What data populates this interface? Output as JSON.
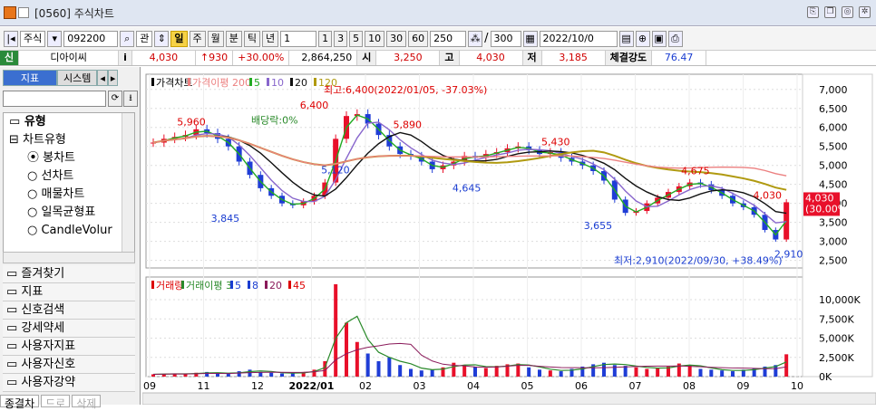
{
  "window": {
    "title": "[0560] 주식차트",
    "code_badge": "1"
  },
  "toolbar": {
    "market": "주식",
    "code": "092200",
    "label_compare": "관",
    "period_sel": "일",
    "periods": [
      "주",
      "월",
      "분",
      "틱",
      "년"
    ],
    "count_sel": "1",
    "minutes": [
      "1",
      "3",
      "5",
      "10",
      "30",
      "60"
    ],
    "count": "250",
    "page": "300",
    "date": "2022/10/0"
  },
  "info": {
    "badge": "신",
    "name": "디아이씨",
    "info_icon": "i",
    "price": "4,030",
    "change": "↑930",
    "rate": "+30.00%",
    "volume": "2,864,250",
    "open_label": "시",
    "open": "3,250",
    "high_label": "고",
    "high": "4,030",
    "low_label": "저",
    "low": "3,185",
    "strength_label": "체결강도",
    "strength": "76.47"
  },
  "sidebar": {
    "tabs": [
      "지표",
      "시스템"
    ],
    "tree": {
      "root": "유형",
      "group": "차트유형",
      "items": [
        "봉차트",
        "선차트",
        "매물차트",
        "일목균형표",
        "CandleVolur"
      ]
    },
    "folders": [
      "즐겨찾기",
      "지표",
      "신호검색",
      "강세약세",
      "사용자지표",
      "사용자신호",
      "사용자강약"
    ],
    "bottom_tabs": [
      "종결차",
      "드로",
      "삭제"
    ]
  },
  "chart_data": [
    {
      "type": "candlestick",
      "title": "가격차트",
      "legend": [
        "가격차트",
        "가격이평 200",
        "5",
        "10",
        "20",
        "120"
      ],
      "colors": {
        "up": "#e8102a",
        "down": "#1f3dd6",
        "ma5": "#22aa22",
        "ma10": "#8866cc",
        "ma20": "#111111",
        "ma120": "#b09a10",
        "ma200": "#ec8080"
      },
      "ylim": [
        2300,
        7400
      ],
      "y_ticks": [
        "7,000",
        "6,500",
        "6,000",
        "5,500",
        "5,000",
        "4,500",
        "4,000",
        "3,500",
        "3,000",
        "2,500"
      ],
      "x_ticks": [
        "09",
        "11",
        "12",
        "2022/01",
        "02",
        "03",
        "04",
        "05",
        "06",
        "07",
        "08",
        "09",
        "10"
      ],
      "series": {
        "close_trend": [
          5600,
          5700,
          5750,
          5800,
          5950,
          5850,
          5700,
          5500,
          5100,
          4750,
          4400,
          4200,
          4000,
          3950,
          4050,
          4200,
          4550,
          5700,
          6300,
          6350,
          6100,
          5800,
          5500,
          5300,
          5250,
          5100,
          4900,
          5000,
          5100,
          5250,
          5200,
          5300,
          5350,
          5450,
          5500,
          5400,
          5300,
          5350,
          5200,
          5100,
          5000,
          4850,
          4600,
          4100,
          3750,
          3800,
          4000,
          4150,
          4300,
          4450,
          4550,
          4500,
          4350,
          4200,
          4000,
          3900,
          3700,
          3300,
          3050,
          4030
        ]
      },
      "annotations": [
        "5,960",
        "6,400",
        "5,890",
        "5,430",
        "4,675",
        "4,030",
        "3,845",
        "5,120",
        "4,645",
        "3,655",
        "2,910",
        "배당락:0%",
        "최고:6,400(2022/01/05, -37.03%)",
        "최저:2,910(2022/09/30, +38.49%)"
      ],
      "last_label": "4,030",
      "last_rate": "(30.00%)"
    },
    {
      "type": "bar",
      "title": "거래량",
      "legend": [
        "거래량",
        "거래이평 3",
        "5",
        "8",
        "20",
        "45"
      ],
      "ylim": [
        0,
        12000
      ],
      "y_ticks": [
        "10,000K",
        "7,500K",
        "5,000K",
        "2,500K",
        "0K"
      ],
      "values": [
        300,
        350,
        400,
        300,
        500,
        600,
        400,
        350,
        700,
        900,
        600,
        500,
        400,
        450,
        600,
        900,
        2000,
        12000,
        7000,
        4500,
        3000,
        2000,
        2500,
        1500,
        1000,
        800,
        900,
        1200,
        1800,
        1500,
        1300,
        1100,
        1400,
        1600,
        1700,
        1200,
        900,
        800,
        700,
        1000,
        1300,
        1600,
        1800,
        1500,
        1400,
        1200,
        1000,
        1100,
        1300,
        1700,
        1500,
        1000,
        900,
        800,
        700,
        900,
        1100,
        1300,
        1500,
        2900
      ]
    }
  ]
}
